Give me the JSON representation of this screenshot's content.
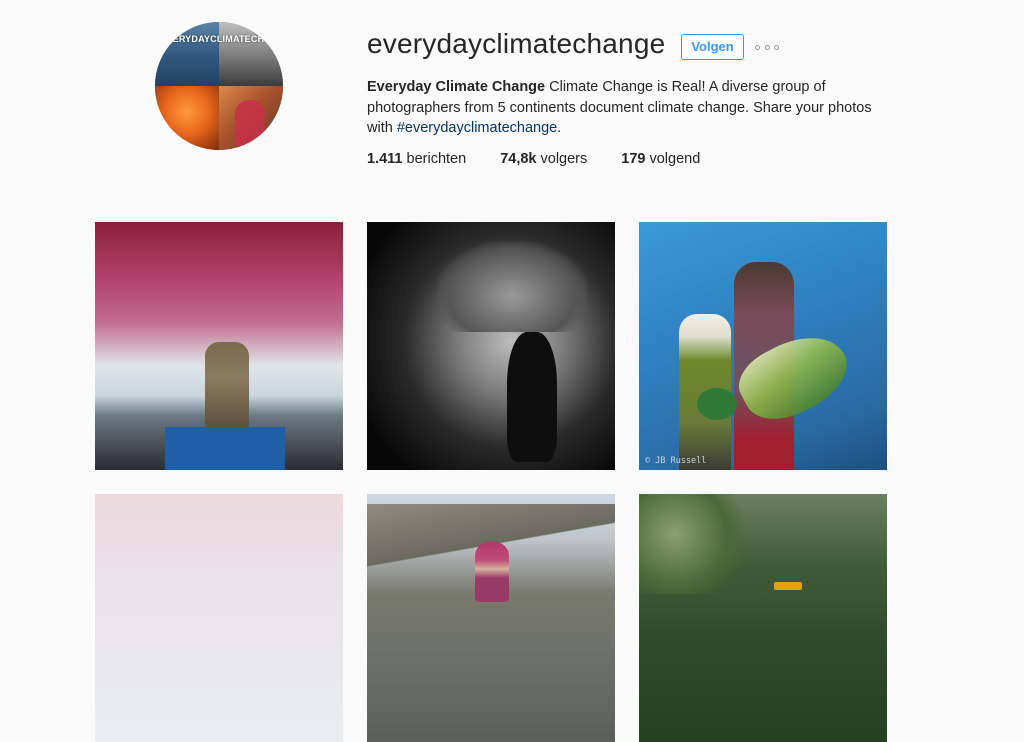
{
  "profile": {
    "avatar_caption": "#EVERYDAYCLIMATECHANGE",
    "username": "everydayclimatechange",
    "follow_label": "Volgen",
    "more_icon": "ellipsis-icon",
    "bio": {
      "full_name": "Everyday Climate Change",
      "text": " Climate Change is Real! A diverse group of photographers from 5 continents document climate change. Share your photos with ",
      "hashtag": "#everydayclimatechange",
      "end": "."
    },
    "stats": {
      "posts_count": "1.411",
      "posts_label": " berichten",
      "followers_count": "74,8k",
      "followers_label": " volgers",
      "following_count": "179",
      "following_label": " volgend"
    }
  },
  "posts": {
    "photo_credit": "© JB Russell"
  },
  "colors": {
    "accent": "#3897f0",
    "hashtag": "#003569",
    "background": "#fafafa",
    "text": "#262626"
  }
}
